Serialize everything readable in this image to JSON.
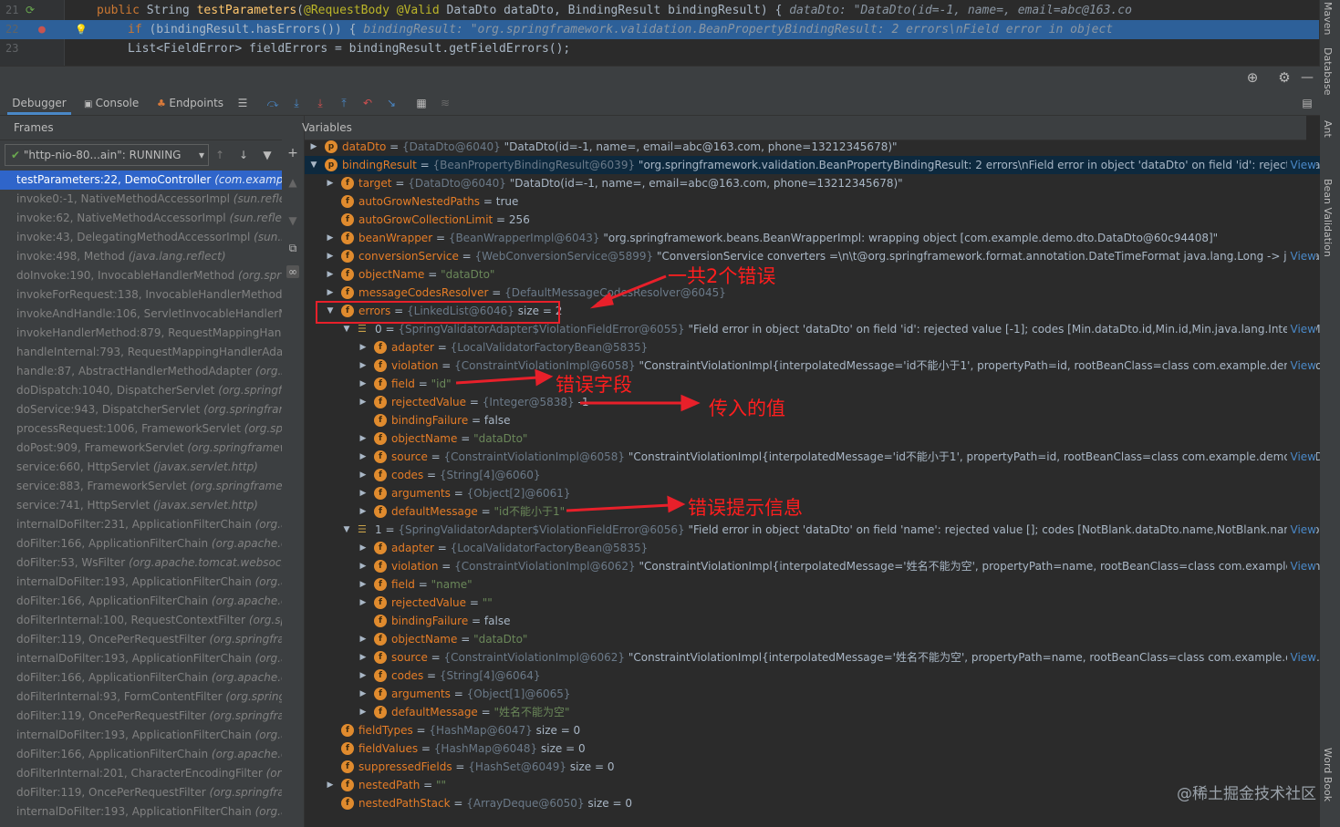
{
  "editor": {
    "lines": [
      {
        "num": "21",
        "parts": [
          [
            "kw",
            "public "
          ],
          [
            "",
            "String "
          ],
          [
            "fn",
            "testParameters"
          ],
          [
            "",
            "("
          ],
          [
            "ann",
            "@RequestBody "
          ],
          [
            "ann",
            "@Valid "
          ],
          [
            "",
            "DataDto dataDto, BindingResult bindingResult) {   "
          ],
          [
            "cm",
            "dataDto: \"DataDto(id=-1, name=, email=abc@163.co"
          ]
        ]
      },
      {
        "num": "22",
        "parts": [
          [
            "kw",
            "if "
          ],
          [
            "",
            "(bindingResult.hasErrors()) {   "
          ],
          [
            "cm",
            "bindingResult: \"org.springframework.validation.BeanPropertyBindingResult: 2 errors\\nField error in object "
          ]
        ]
      },
      {
        "num": "23",
        "parts": [
          [
            "",
            "    List<FieldError> fieldErrors = bindingResult.getFieldErrors();"
          ]
        ]
      }
    ]
  },
  "right_tabs": [
    "Maven",
    "Database",
    "Ant",
    "Bean Validation",
    "Word Book"
  ],
  "tabs": [
    "Debugger",
    "Console",
    "Endpoints"
  ],
  "frames_title": "Frames",
  "variables_title": "Variables",
  "thread_select": "\"http-nio-80...ain\": RUNNING",
  "frames": [
    {
      "method": "testParameters:22, DemoController",
      "pkg": "(com.example"
    },
    {
      "method": "invoke0:-1, NativeMethodAccessorImpl",
      "pkg": "(sun.refle"
    },
    {
      "method": "invoke:62, NativeMethodAccessorImpl",
      "pkg": "(sun.reflec"
    },
    {
      "method": "invoke:43, DelegatingMethodAccessorImpl",
      "pkg": "(sun.r"
    },
    {
      "method": "invoke:498, Method",
      "pkg": "(java.lang.reflect)"
    },
    {
      "method": "doInvoke:190, InvocableHandlerMethod",
      "pkg": "(org.spr"
    },
    {
      "method": "invokeForRequest:138, InvocableHandlerMethod",
      "pkg": ""
    },
    {
      "method": "invokeAndHandle:106, ServletInvocableHandlerMe",
      "pkg": ""
    },
    {
      "method": "invokeHandlerMethod:879, RequestMappingHand",
      "pkg": ""
    },
    {
      "method": "handleInternal:793, RequestMappingHandlerAda",
      "pkg": ""
    },
    {
      "method": "handle:87, AbstractHandlerMethodAdapter",
      "pkg": "(org.s"
    },
    {
      "method": "doDispatch:1040, DispatcherServlet",
      "pkg": "(org.springfra"
    },
    {
      "method": "doService:943, DispatcherServlet",
      "pkg": "(org.springfram"
    },
    {
      "method": "processRequest:1006, FrameworkServlet",
      "pkg": "(org.spr"
    },
    {
      "method": "doPost:909, FrameworkServlet",
      "pkg": "(org.springframew"
    },
    {
      "method": "service:660, HttpServlet",
      "pkg": "(javax.servlet.http)"
    },
    {
      "method": "service:883, FrameworkServlet",
      "pkg": "(org.springframew"
    },
    {
      "method": "service:741, HttpServlet",
      "pkg": "(javax.servlet.http)"
    },
    {
      "method": "internalDoFilter:231, ApplicationFilterChain",
      "pkg": "(org.a"
    },
    {
      "method": "doFilter:166, ApplicationFilterChain",
      "pkg": "(org.apache.c"
    },
    {
      "method": "doFilter:53, WsFilter",
      "pkg": "(org.apache.tomcat.websock"
    },
    {
      "method": "internalDoFilter:193, ApplicationFilterChain",
      "pkg": "(org.a"
    },
    {
      "method": "doFilter:166, ApplicationFilterChain",
      "pkg": "(org.apache.ca"
    },
    {
      "method": "doFilterInternal:100, RequestContextFilter",
      "pkg": "(org.spr"
    },
    {
      "method": "doFilter:119, OncePerRequestFilter",
      "pkg": "(org.springfram"
    },
    {
      "method": "internalDoFilter:193, ApplicationFilterChain",
      "pkg": "(org.ap"
    },
    {
      "method": "doFilter:166, ApplicationFilterChain",
      "pkg": "(org.apache.ca"
    },
    {
      "method": "doFilterInternal:93, FormContentFilter",
      "pkg": "(org.springf"
    },
    {
      "method": "doFilter:119, OncePerRequestFilter",
      "pkg": "(org.springfram"
    },
    {
      "method": "internalDoFilter:193, ApplicationFilterChain",
      "pkg": "(org.ap"
    },
    {
      "method": "doFilter:166, ApplicationFilterChain",
      "pkg": "(org.apache.ca"
    },
    {
      "method": "doFilterInternal:201, CharacterEncodingFilter",
      "pkg": "(org."
    },
    {
      "method": "doFilter:119, OncePerRequestFilter",
      "pkg": "(org.springfram"
    },
    {
      "method": "internalDoFilter:193, ApplicationFilterChain",
      "pkg": "(org.ap"
    }
  ],
  "variables": [
    {
      "indent": 0,
      "arrow": "right",
      "icon": "p",
      "name": "dataDto",
      "meta": "{DataDto@6040}",
      "value": "\"DataDto(id=-1, name=, email=abc@163.com, phone=13212345678)\"",
      "view": ""
    },
    {
      "indent": 0,
      "arrow": "down",
      "icon": "p",
      "name": "bindingResult",
      "meta": "{BeanPropertyBindingResult@6039}",
      "value": "\"org.springframework.validation.BeanPropertyBindingResult: 2 errors\\nField error in object 'dataDto' on field 'id': rejected va...",
      "view": "View",
      "sel": true
    },
    {
      "indent": 1,
      "arrow": "right",
      "icon": "f",
      "name": "target",
      "meta": "{DataDto@6040}",
      "value": "\"DataDto(id=-1, name=, email=abc@163.com, phone=13212345678)\"",
      "view": ""
    },
    {
      "indent": 1,
      "arrow": "",
      "icon": "f",
      "name": "autoGrowNestedPaths",
      "meta": "",
      "value": "true",
      "view": ""
    },
    {
      "indent": 1,
      "arrow": "",
      "icon": "f",
      "name": "autoGrowCollectionLimit",
      "meta": "",
      "value": "256",
      "view": ""
    },
    {
      "indent": 1,
      "arrow": "right",
      "icon": "f",
      "name": "beanWrapper",
      "meta": "{BeanWrapperImpl@6043}",
      "value": "\"org.springframework.beans.BeanWrapperImpl: wrapping object [com.example.demo.dto.DataDto@60c94408]\"",
      "view": ""
    },
    {
      "indent": 1,
      "arrow": "right",
      "icon": "f",
      "name": "conversionService",
      "meta": "{WebConversionService@5899}",
      "value": "\"ConversionService converters =\\n\\t@org.springframework.format.annotation.DateTimeFormat java.lang.Long -> java.lan...",
      "view": "View"
    },
    {
      "indent": 1,
      "arrow": "right",
      "icon": "f",
      "name": "objectName",
      "meta": "",
      "value": "",
      "str": "\"dataDto\"",
      "view": ""
    },
    {
      "indent": 1,
      "arrow": "right",
      "icon": "f",
      "name": "messageCodesResolver",
      "meta": "{DefaultMessageCodesResolver@6045}",
      "value": "",
      "view": ""
    },
    {
      "indent": 1,
      "arrow": "down",
      "icon": "f",
      "name": "errors",
      "meta": "{LinkedList@6046}",
      "value": " size = 2",
      "view": ""
    },
    {
      "indent": 2,
      "arrow": "down",
      "icon": "list",
      "name": "0",
      "meta": "{SpringValidatorAdapter$ViolationFieldError@6055}",
      "value": "\"Field error in object 'dataDto' on field 'id': rejected value [-1]; codes [Min.dataDto.id,Min.id,Min.java.lang.Integer,M...",
      "view": "View"
    },
    {
      "indent": 3,
      "arrow": "right",
      "icon": "f",
      "name": "adapter",
      "meta": "{LocalValidatorFactoryBean@5835}",
      "value": "",
      "view": ""
    },
    {
      "indent": 3,
      "arrow": "right",
      "icon": "f",
      "name": "violation",
      "meta": "{ConstraintViolationImpl@6058}",
      "value": "\"ConstraintViolationImpl{interpolatedMessage='id不能小于1', propertyPath=id, rootBeanClass=class com.example.demo.dto...",
      "view": "View"
    },
    {
      "indent": 3,
      "arrow": "right",
      "icon": "f",
      "name": "field",
      "meta": "",
      "value": "",
      "str": "\"id\"",
      "view": ""
    },
    {
      "indent": 3,
      "arrow": "right",
      "icon": "f",
      "name": "rejectedValue",
      "meta": "{Integer@5838}",
      "value": "-1",
      "view": ""
    },
    {
      "indent": 3,
      "arrow": "",
      "icon": "f",
      "name": "bindingFailure",
      "meta": "",
      "value": "false",
      "view": ""
    },
    {
      "indent": 3,
      "arrow": "right",
      "icon": "f",
      "name": "objectName",
      "meta": "",
      "value": "",
      "str": "\"dataDto\"",
      "view": ""
    },
    {
      "indent": 3,
      "arrow": "right",
      "icon": "f",
      "name": "source",
      "meta": "{ConstraintViolationImpl@6058}",
      "value": "\"ConstraintViolationImpl{interpolatedMessage='id不能小于1', propertyPath=id, rootBeanClass=class com.example.demo.dto.D...",
      "view": "View"
    },
    {
      "indent": 3,
      "arrow": "right",
      "icon": "f",
      "name": "codes",
      "meta": "{String[4]@6060}",
      "value": "",
      "view": ""
    },
    {
      "indent": 3,
      "arrow": "right",
      "icon": "f",
      "name": "arguments",
      "meta": "{Object[2]@6061}",
      "value": "",
      "view": ""
    },
    {
      "indent": 3,
      "arrow": "right",
      "icon": "f",
      "name": "defaultMessage",
      "meta": "",
      "value": "",
      "str": "\"id不能小于1\"",
      "view": ""
    },
    {
      "indent": 2,
      "arrow": "down",
      "icon": "list",
      "name": "1",
      "meta": "{SpringValidatorAdapter$ViolationFieldError@6056}",
      "value": "\"Field error in object 'dataDto' on field 'name': rejected value []; codes [NotBlank.dataDto.name,NotBlank.name,No...",
      "view": "View"
    },
    {
      "indent": 3,
      "arrow": "right",
      "icon": "f",
      "name": "adapter",
      "meta": "{LocalValidatorFactoryBean@5835}",
      "value": "",
      "view": ""
    },
    {
      "indent": 3,
      "arrow": "right",
      "icon": "f",
      "name": "violation",
      "meta": "{ConstraintViolationImpl@6062}",
      "value": "\"ConstraintViolationImpl{interpolatedMessage='姓名不能为空', propertyPath=name, rootBeanClass=class com.example.demo...",
      "view": "View"
    },
    {
      "indent": 3,
      "arrow": "right",
      "icon": "f",
      "name": "field",
      "meta": "",
      "value": "",
      "str": "\"name\"",
      "view": ""
    },
    {
      "indent": 3,
      "arrow": "right",
      "icon": "f",
      "name": "rejectedValue",
      "meta": "",
      "value": "",
      "str": "\"\"",
      "view": ""
    },
    {
      "indent": 3,
      "arrow": "",
      "icon": "f",
      "name": "bindingFailure",
      "meta": "",
      "value": "false",
      "view": ""
    },
    {
      "indent": 3,
      "arrow": "right",
      "icon": "f",
      "name": "objectName",
      "meta": "",
      "value": "",
      "str": "\"dataDto\"",
      "view": ""
    },
    {
      "indent": 3,
      "arrow": "right",
      "icon": "f",
      "name": "source",
      "meta": "{ConstraintViolationImpl@6062}",
      "value": "\"ConstraintViolationImpl{interpolatedMessage='姓名不能为空', propertyPath=name, rootBeanClass=class com.example.demo.c...",
      "view": "View"
    },
    {
      "indent": 3,
      "arrow": "right",
      "icon": "f",
      "name": "codes",
      "meta": "{String[4]@6064}",
      "value": "",
      "view": ""
    },
    {
      "indent": 3,
      "arrow": "right",
      "icon": "f",
      "name": "arguments",
      "meta": "{Object[1]@6065}",
      "value": "",
      "view": ""
    },
    {
      "indent": 3,
      "arrow": "right",
      "icon": "f",
      "name": "defaultMessage",
      "meta": "",
      "value": "",
      "str": "\"姓名不能为空\"",
      "view": ""
    },
    {
      "indent": 1,
      "arrow": "",
      "icon": "f",
      "name": "fieldTypes",
      "meta": "{HashMap@6047}",
      "value": " size = 0",
      "view": ""
    },
    {
      "indent": 1,
      "arrow": "",
      "icon": "f",
      "name": "fieldValues",
      "meta": "{HashMap@6048}",
      "value": " size = 0",
      "view": ""
    },
    {
      "indent": 1,
      "arrow": "",
      "icon": "f",
      "name": "suppressedFields",
      "meta": "{HashSet@6049}",
      "value": " size = 0",
      "view": ""
    },
    {
      "indent": 1,
      "arrow": "right",
      "icon": "f",
      "name": "nestedPath",
      "meta": "",
      "value": "",
      "str": "\"\"",
      "view": ""
    },
    {
      "indent": 1,
      "arrow": "",
      "icon": "f",
      "name": "nestedPathStack",
      "meta": "{ArrayDeque@6050}",
      "value": " size = 0",
      "view": ""
    }
  ],
  "annotations": {
    "errors_count": "一共2个错误",
    "error_field": "错误字段",
    "passed_value": "传入的值",
    "error_message": "错误提示信息"
  },
  "watermark": "@稀土掘金技术社区"
}
